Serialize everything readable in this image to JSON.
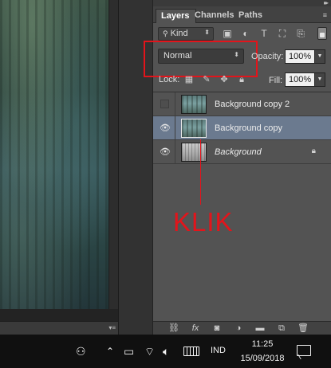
{
  "tabs": [
    {
      "label": "Layers",
      "active": true
    },
    {
      "label": "Channels",
      "active": false
    },
    {
      "label": "Paths",
      "active": false
    }
  ],
  "filter": {
    "kind_label": "Kind",
    "icons": [
      "search-icon",
      "image-filter-icon",
      "adjustment-filter-icon",
      "type-filter-icon",
      "shape-filter-icon",
      "smart-object-filter-icon",
      "filter-toggle"
    ]
  },
  "blend_mode": "Normal",
  "opacity": {
    "label": "Opacity:",
    "value": "100%"
  },
  "lock": {
    "label": "Lock:",
    "icons": [
      "lock-transparent-icon",
      "lock-image-icon",
      "lock-position-icon",
      "lock-all-icon"
    ]
  },
  "fill": {
    "label": "Fill:",
    "value": "100%"
  },
  "layers": [
    {
      "name": "Background copy 2",
      "visible": false,
      "selected": false,
      "italic": false,
      "locked": false
    },
    {
      "name": "Background copy",
      "visible": true,
      "selected": true,
      "italic": false,
      "locked": false
    },
    {
      "name": "Background",
      "visible": true,
      "selected": false,
      "italic": true,
      "locked": true
    }
  ],
  "annotation": {
    "text": "KLIK",
    "color": "#e3141b"
  },
  "footer_icons": [
    "link-layers-icon",
    "fx-icon",
    "mask-icon",
    "adjustment-layer-icon",
    "group-folder-icon",
    "new-layer-icon",
    "trash-icon"
  ],
  "taskbar": {
    "language": "IND",
    "time": "11:25",
    "date": "15/09/2018"
  },
  "colors": {
    "panel_bg": "#535353",
    "selected_layer": "#6b7a8f",
    "highlight_red": "#e3141b",
    "taskbar_bg": "#101010"
  }
}
